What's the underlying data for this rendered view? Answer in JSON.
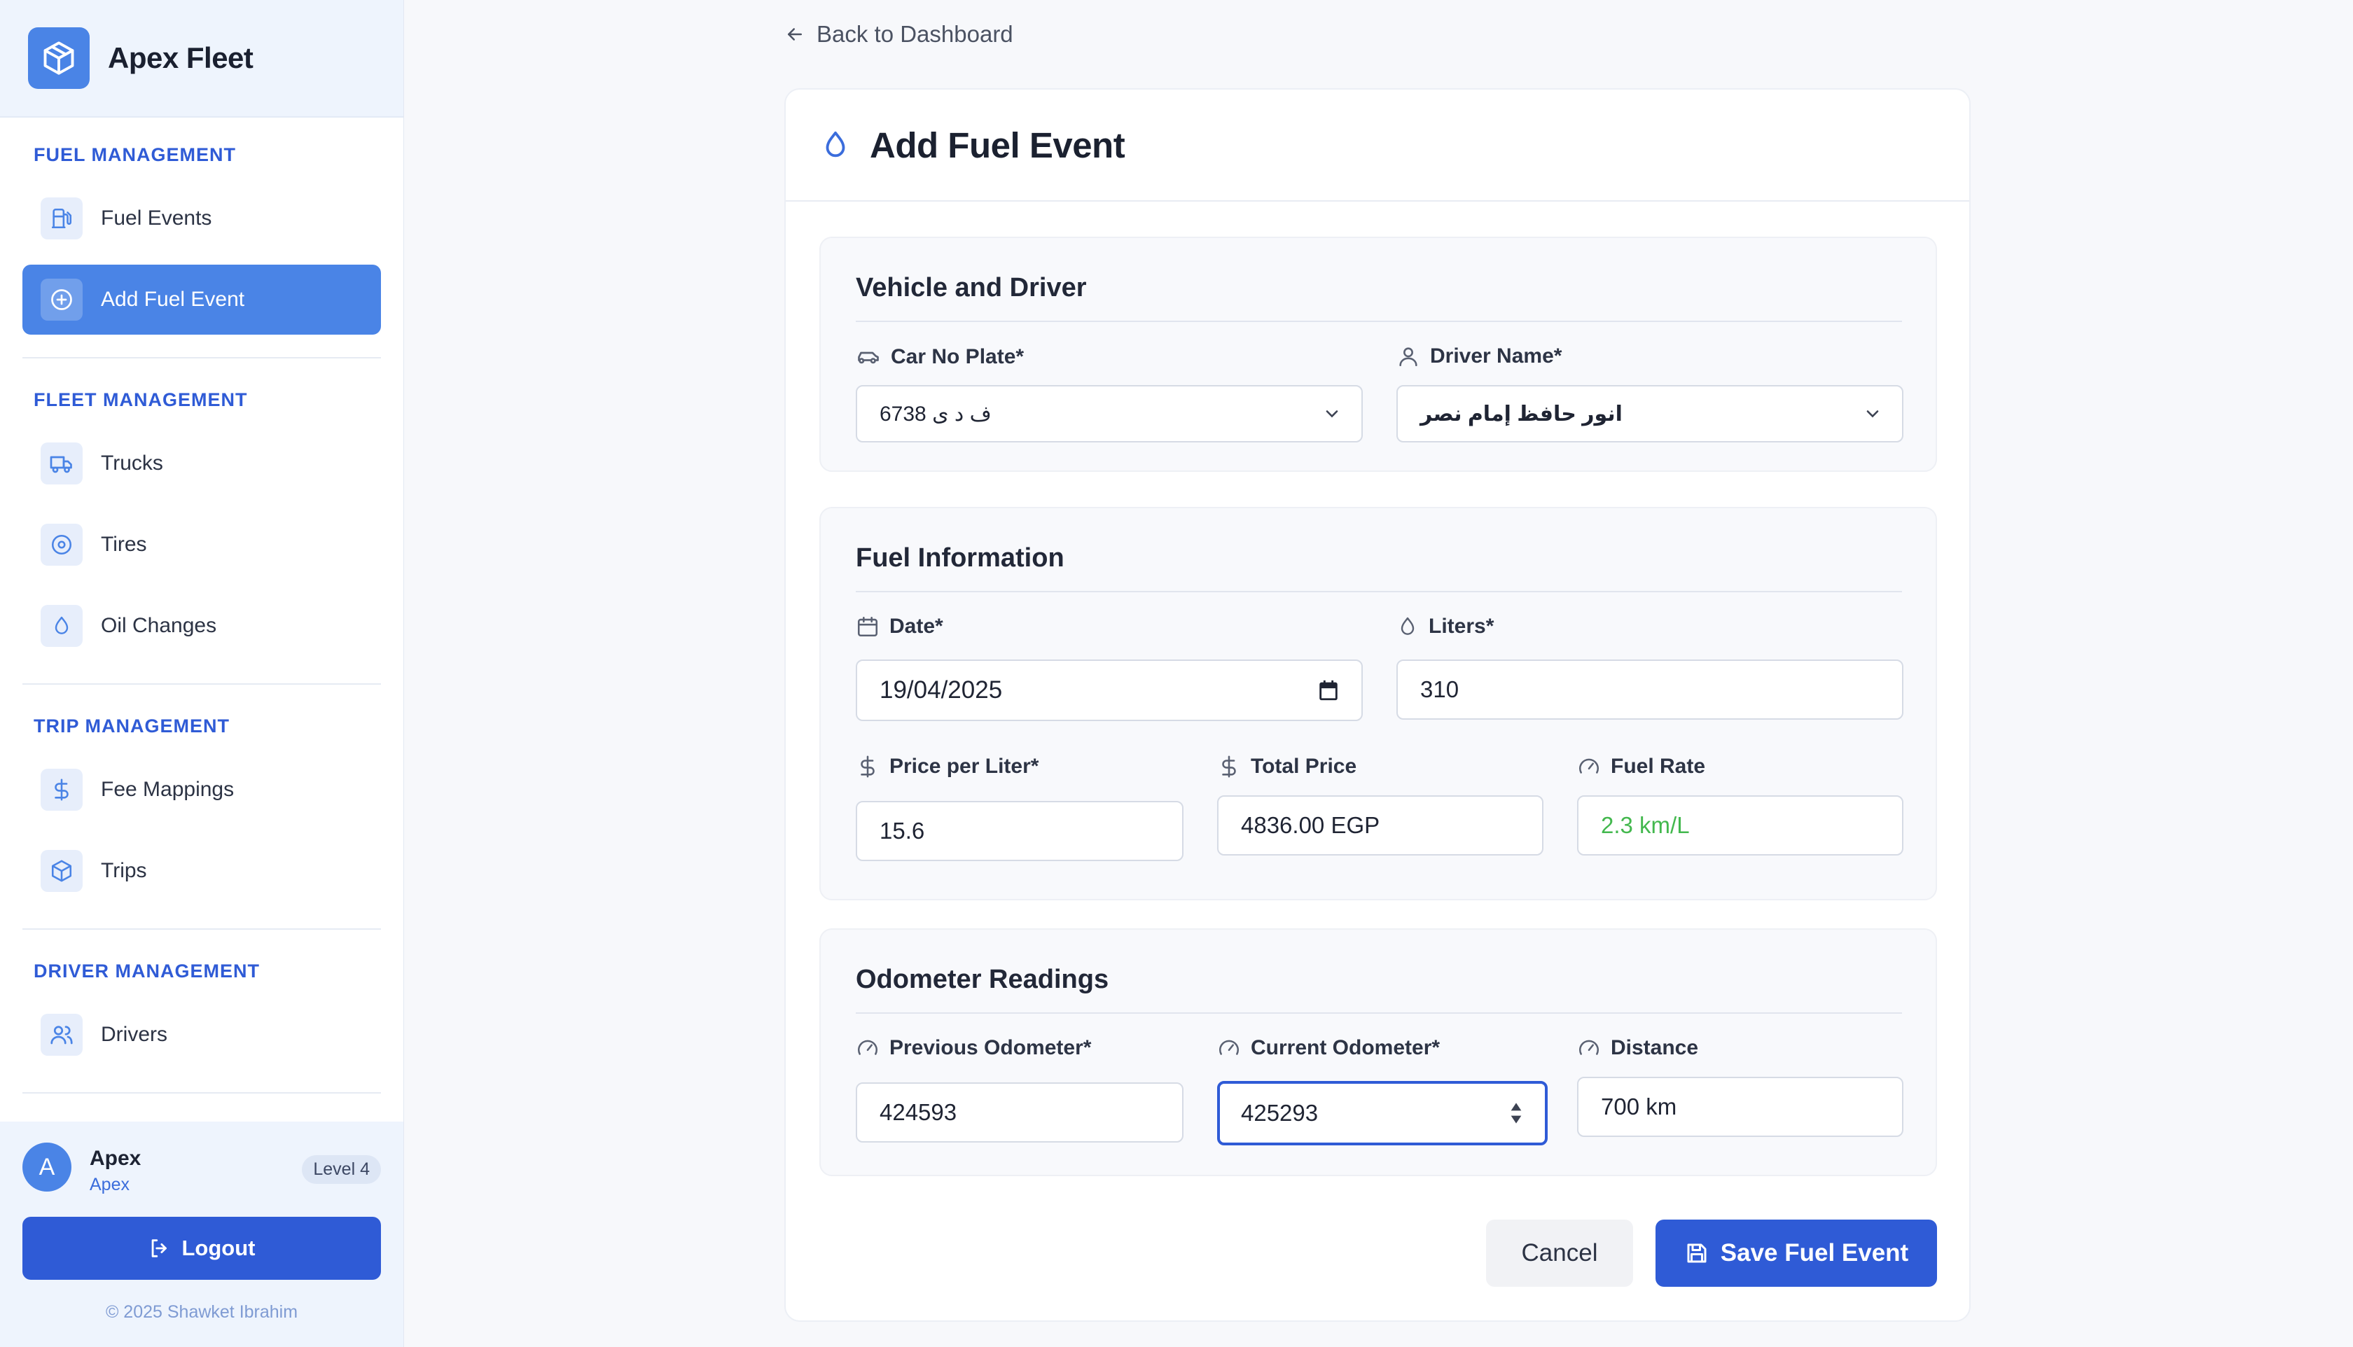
{
  "app": {
    "name": "Apex Fleet",
    "logo_icon": "cube-icon",
    "accent": "#2f5bd6"
  },
  "sidebar": {
    "sections": [
      {
        "title": "FUEL MANAGEMENT",
        "items": [
          {
            "label": "Fuel Events",
            "icon": "fuel-pump-icon",
            "active": false
          },
          {
            "label": "Add Fuel Event",
            "icon": "plus-circle-icon",
            "active": true
          }
        ]
      },
      {
        "title": "FLEET MANAGEMENT",
        "items": [
          {
            "label": "Trucks",
            "icon": "truck-icon",
            "active": false
          },
          {
            "label": "Tires",
            "icon": "tire-icon",
            "active": false
          },
          {
            "label": "Oil Changes",
            "icon": "droplet-icon",
            "active": false
          }
        ]
      },
      {
        "title": "TRIP MANAGEMENT",
        "items": [
          {
            "label": "Fee Mappings",
            "icon": "dollar-icon",
            "active": false
          },
          {
            "label": "Trips",
            "icon": "package-icon",
            "active": false
          }
        ]
      },
      {
        "title": "DRIVER MANAGEMENT",
        "items": [
          {
            "label": "Drivers",
            "icon": "users-icon",
            "active": false
          }
        ]
      }
    ],
    "user": {
      "initial": "A",
      "name": "Apex",
      "role": "Apex",
      "level": "Level 4"
    },
    "logout_label": "Logout",
    "copyright": "© 2025 Shawket Ibrahim"
  },
  "main": {
    "back_label": "Back to Dashboard",
    "title": "Add Fuel Event",
    "vehicle_driver": {
      "title": "Vehicle and Driver",
      "car_plate_label": "Car No Plate*",
      "car_plate_value": "ف د ى 6738",
      "driver_label": "Driver Name*",
      "driver_value": "انور حافظ إمام نصر"
    },
    "fuel_info": {
      "title": "Fuel Information",
      "date_label": "Date*",
      "date_value": "19/04/2025",
      "liters_label": "Liters*",
      "liters_value": "310",
      "price_label": "Price per Liter*",
      "price_value": "15.6",
      "total_label": "Total Price",
      "total_value": "4836.00 EGP",
      "rate_label": "Fuel Rate",
      "rate_value": "2.3 km/L",
      "rate_color": "#43b84e"
    },
    "odometer": {
      "title": "Odometer Readings",
      "previous_label": "Previous Odometer*",
      "previous_value": "424593",
      "current_label": "Current Odometer*",
      "current_value": "425293",
      "distance_label": "Distance",
      "distance_value": "700 km"
    },
    "actions": {
      "cancel_label": "Cancel",
      "save_label": "Save Fuel Event"
    }
  }
}
